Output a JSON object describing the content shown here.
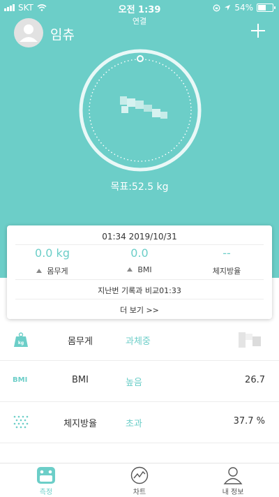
{
  "status_bar": {
    "carrier": "SKT",
    "time": "오전 1:39",
    "battery": "54%",
    "battery_level": 0.54
  },
  "connection_label": "연결",
  "header": {
    "username": "임츄"
  },
  "gauge": {
    "goal_text": "목표:52.5 kg"
  },
  "card": {
    "datetime": "01:34 2019/10/31",
    "metrics": [
      {
        "value": "0.0 kg",
        "label": "몸무게",
        "has_arrow": true
      },
      {
        "value": "0.0",
        "label": "BMI",
        "has_arrow": true
      },
      {
        "value": "--",
        "label": "체지방율",
        "has_arrow": false
      }
    ],
    "compare_text": "지난번 기록과 비교01:33",
    "more_text": "더 보기 >>"
  },
  "list": [
    {
      "icon": "scale-icon",
      "name": "몸무게",
      "status": "과체중",
      "value": ""
    },
    {
      "icon": "bmi-icon",
      "icon_text": "BMI",
      "name": "BMI",
      "status": "높음",
      "value": "26.7"
    },
    {
      "icon": "body-fat-icon",
      "name": "체지방율",
      "status": "초과",
      "value": "37.7 %"
    }
  ],
  "tabs": [
    {
      "label": "측정",
      "icon": "measure-icon",
      "active": true
    },
    {
      "label": "차트",
      "icon": "chart-icon",
      "active": false
    },
    {
      "label": "내 정보",
      "icon": "profile-icon",
      "active": false
    }
  ],
  "colors": {
    "accent": "#6ccec8",
    "background_top": "#6ccec8"
  }
}
